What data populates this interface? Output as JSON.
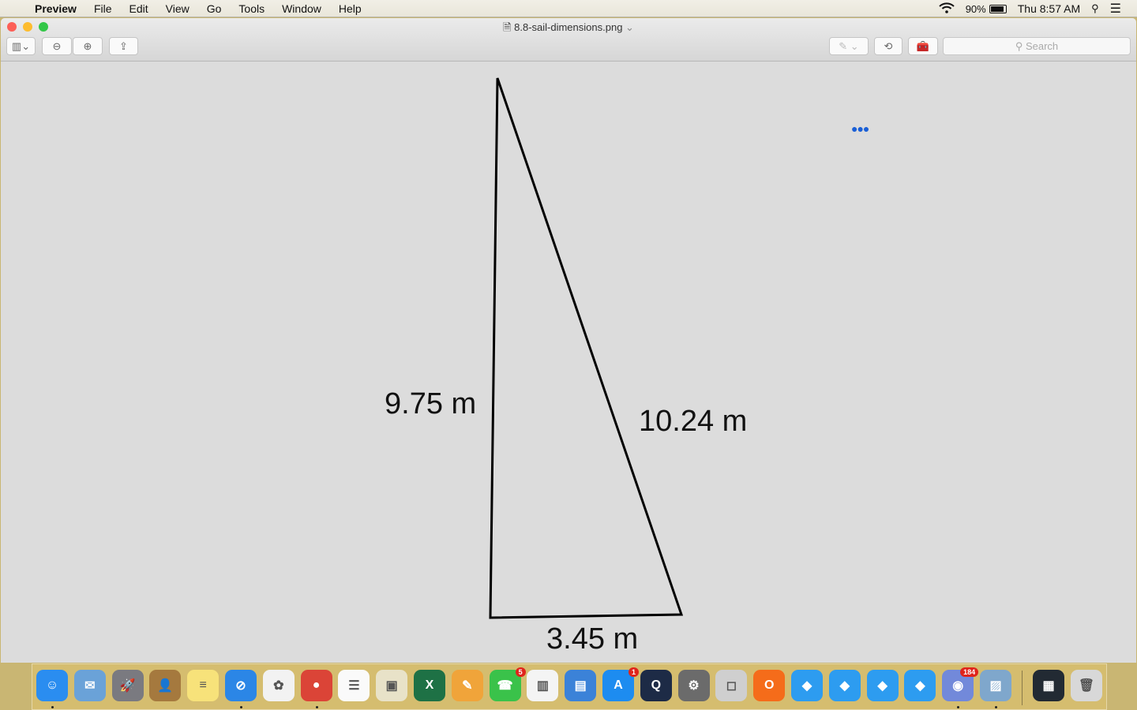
{
  "menubar": {
    "app": "Preview",
    "items": [
      "File",
      "Edit",
      "View",
      "Go",
      "Tools",
      "Window",
      "Help"
    ],
    "battery": "90%",
    "clock": "Thu 8:57 AM"
  },
  "window": {
    "title": "8.8-sail-dimensions.png",
    "search_placeholder": "Search"
  },
  "figure": {
    "left_label": "9.75 m",
    "hyp_label": "10.24 m",
    "base_label": "3.45 m"
  },
  "dock": [
    {
      "name": "finder",
      "color": "#2a8df0",
      "glyph": "☺",
      "run": true
    },
    {
      "name": "mail",
      "color": "#6aa2d8",
      "glyph": "✉"
    },
    {
      "name": "launchpad",
      "color": "#7a7a80",
      "glyph": "🚀"
    },
    {
      "name": "contacts",
      "color": "#a5793e",
      "glyph": "👤"
    },
    {
      "name": "notes",
      "color": "#f7e27a",
      "glyph": "≡"
    },
    {
      "name": "safari",
      "color": "#2b86e6",
      "glyph": "⊘",
      "run": true
    },
    {
      "name": "photos",
      "color": "#f2f2f2",
      "glyph": "✿"
    },
    {
      "name": "chrome",
      "color": "#db4437",
      "glyph": "●",
      "run": true
    },
    {
      "name": "reminders",
      "color": "#fafafa",
      "glyph": "☰"
    },
    {
      "name": "preview-app",
      "color": "#e8e2c8",
      "glyph": "▣"
    },
    {
      "name": "excel",
      "color": "#1e7145",
      "glyph": "X"
    },
    {
      "name": "pages",
      "color": "#f0a43a",
      "glyph": "✎"
    },
    {
      "name": "facetime",
      "color": "#3ac24a",
      "glyph": "☎",
      "badge": "5"
    },
    {
      "name": "numbers",
      "color": "#f4f4f4",
      "glyph": "▥"
    },
    {
      "name": "keynote",
      "color": "#3b82d8",
      "glyph": "▤"
    },
    {
      "name": "app-store",
      "color": "#1d8cf0",
      "glyph": "A",
      "badge": "1"
    },
    {
      "name": "quicktime",
      "color": "#1d2b46",
      "glyph": "Q"
    },
    {
      "name": "system-preferences",
      "color": "#6b6b6b",
      "glyph": "⚙"
    },
    {
      "name": "roblox-studio",
      "color": "#cfcfcf",
      "glyph": "◻"
    },
    {
      "name": "origin",
      "color": "#f56c1a",
      "glyph": "O"
    },
    {
      "name": "roblox-1",
      "color": "#2d9cf0",
      "glyph": "◆"
    },
    {
      "name": "roblox-2",
      "color": "#2d9cf0",
      "glyph": "◆"
    },
    {
      "name": "roblox-3",
      "color": "#2d9cf0",
      "glyph": "◆"
    },
    {
      "name": "roblox-4",
      "color": "#2d9cf0",
      "glyph": "◆"
    },
    {
      "name": "discord",
      "color": "#7289da",
      "glyph": "◉",
      "badge": "184",
      "run": true
    },
    {
      "name": "image-viewer",
      "color": "#7fa7cc",
      "glyph": "▨",
      "run": true
    },
    {
      "name": "discord-window",
      "color": "#222a33",
      "glyph": "▦"
    },
    {
      "name": "trash",
      "color": "#d8d8d8",
      "glyph": "🗑"
    }
  ]
}
